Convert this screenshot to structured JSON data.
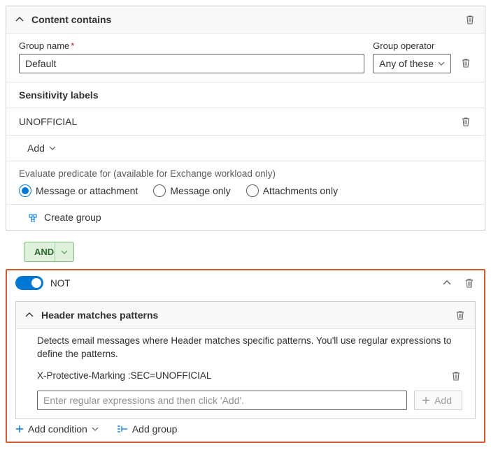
{
  "content": {
    "title": "Content contains",
    "group_name_label": "Group name",
    "group_name_value": "Default",
    "operator_label": "Group operator",
    "operator_value": "Any of these",
    "sensitivity_label": "Sensitivity labels",
    "sensitivity_item": "UNOFFICIAL",
    "add_label": "Add",
    "evaluate_hint": "Evaluate predicate for (available for Exchange workload only)",
    "radio1": "Message or attachment",
    "radio2": "Message only",
    "radio3": "Attachments only",
    "create_group": "Create group"
  },
  "operator_pill": "AND",
  "not_block": {
    "not_label": "NOT",
    "header": {
      "title": "Header matches patterns",
      "desc": "Detects email messages where Header matches specific patterns. You'll use regular expressions to define the patterns.",
      "pattern_item": "X-Protective-Marking :SEC=UNOFFICIAL",
      "placeholder": "Enter regular expressions and then click 'Add'.",
      "add_btn": "Add"
    },
    "footer": {
      "add_condition": "Add condition",
      "add_group": "Add group"
    }
  }
}
